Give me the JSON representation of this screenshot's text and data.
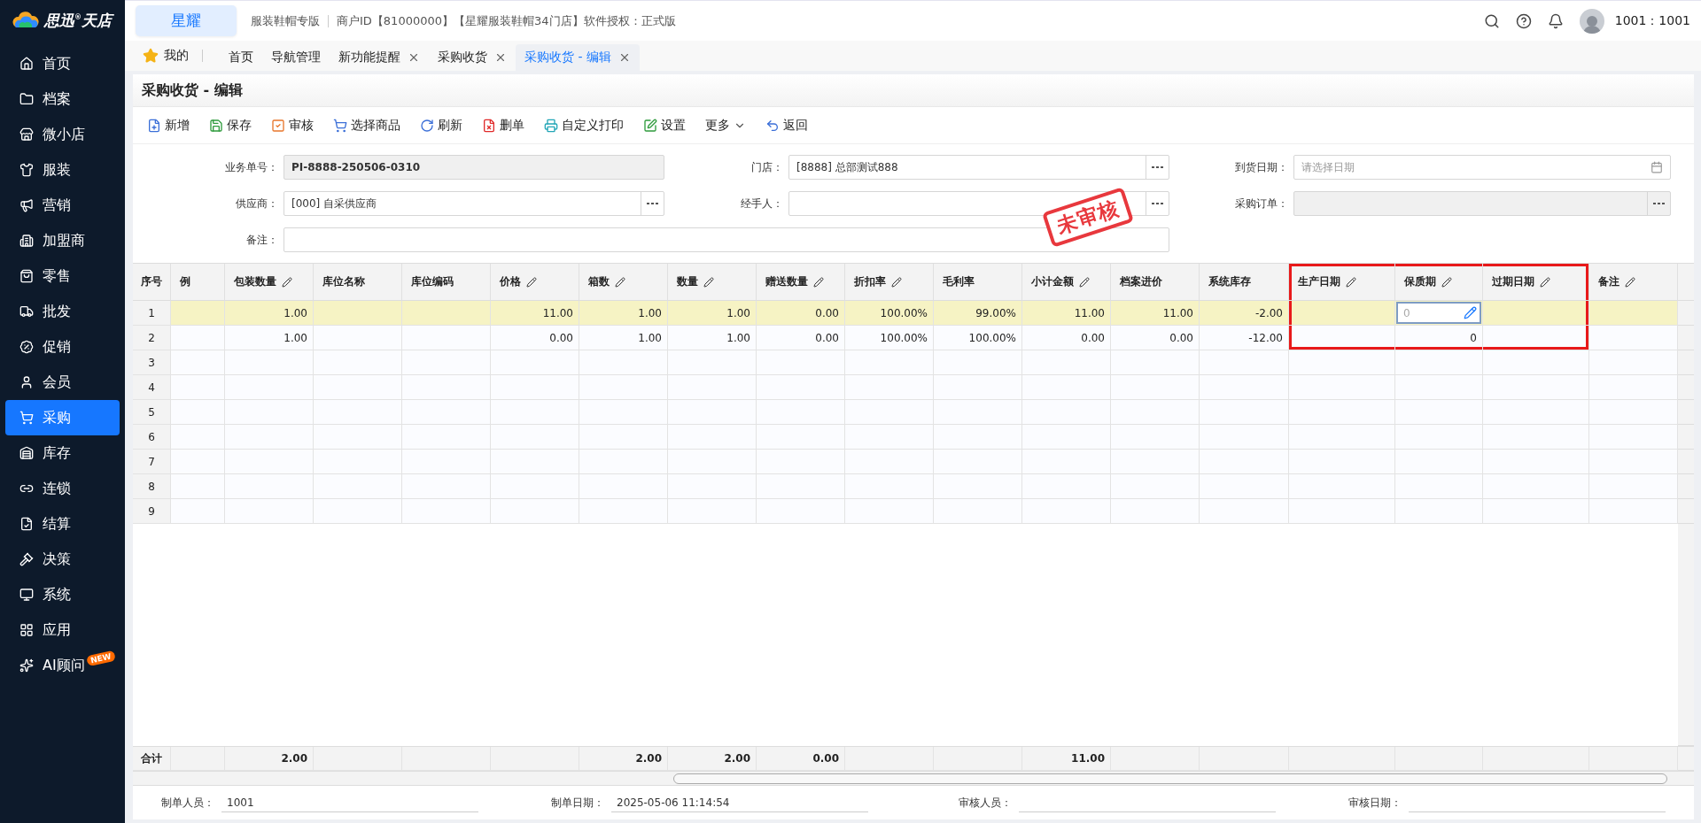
{
  "logo": {
    "text": "思迅$^{®}$天店"
  },
  "sidebar": {
    "items": [
      {
        "label": "首页",
        "selected": false
      },
      {
        "label": "档案",
        "selected": false
      },
      {
        "label": "微小店",
        "selected": false
      },
      {
        "label": "服装",
        "selected": false
      },
      {
        "label": "营销",
        "selected": false
      },
      {
        "label": "加盟商",
        "selected": false
      },
      {
        "label": "零售",
        "selected": false
      },
      {
        "label": "批发",
        "selected": false
      },
      {
        "label": "促销",
        "selected": false
      },
      {
        "label": "会员",
        "selected": false
      },
      {
        "label": "采购",
        "selected": true
      },
      {
        "label": "库存",
        "selected": false
      },
      {
        "label": "连锁",
        "selected": false
      },
      {
        "label": "结算",
        "selected": false
      },
      {
        "label": "决策",
        "selected": false
      },
      {
        "label": "系统",
        "selected": false
      },
      {
        "label": "应用",
        "selected": false
      },
      {
        "label": "AI顾问",
        "selected": false,
        "badge": "NEW"
      }
    ]
  },
  "header": {
    "brand": "星耀",
    "edition": "服装鞋帽专版",
    "info": "商户ID【81000000】【星耀服装鞋帽34门店】软件授权：正式版",
    "user": "1001：1001"
  },
  "tabs": {
    "favorites": "我的",
    "items": [
      {
        "label": "首页",
        "selected": false,
        "closable": false
      },
      {
        "label": "导航管理",
        "selected": false,
        "closable": false
      },
      {
        "label": "新功能提醒",
        "selected": false,
        "closable": true
      },
      {
        "label": "采购收货",
        "selected": false,
        "closable": true
      },
      {
        "label": "采购收货 - 编辑",
        "selected": true,
        "closable": true
      }
    ]
  },
  "page": {
    "title": "采购收货 - 编辑"
  },
  "toolbar": [
    {
      "label": "新增",
      "kind": "add"
    },
    {
      "label": "保存",
      "kind": "save"
    },
    {
      "label": "审核",
      "kind": "approve"
    },
    {
      "label": "选择商品",
      "kind": "cart"
    },
    {
      "label": "刷新",
      "kind": "refresh"
    },
    {
      "label": "删单",
      "kind": "delete"
    },
    {
      "label": "自定义打印",
      "kind": "print"
    },
    {
      "label": "设置",
      "kind": "settings"
    },
    {
      "label": "更多",
      "kind": "more"
    },
    {
      "label": "返回",
      "kind": "back"
    }
  ],
  "form": {
    "stamp": "未审核",
    "fields": [
      {
        "label": "业务单号：",
        "value": "PI-8888-250506-0310",
        "kind": "code",
        "disabled": true
      },
      {
        "label": "门店：",
        "value": "[8888] 总部测试888",
        "kind": "lookup",
        "disabled": false
      },
      {
        "label": "到货日期：",
        "placeholder": "请选择日期",
        "kind": "date",
        "disabled": false
      },
      {
        "label": "供应商：",
        "value": "[000] 自采供应商",
        "kind": "lookup",
        "disabled": false
      },
      {
        "label": "经手人：",
        "kind": "lookup",
        "disabled": false
      },
      {
        "label": "采购订单：",
        "kind": "lookup",
        "disabled": true
      },
      {
        "label": "备注：",
        "kind": "note",
        "disabled": false
      }
    ]
  },
  "table": {
    "columns": [
      {
        "label": "序号",
        "editable": false,
        "framed": false,
        "total": "合计"
      },
      {
        "label": "例",
        "editable": false,
        "framed": false
      },
      {
        "label": "包装数量",
        "editable": true,
        "framed": false,
        "total": "2.00"
      },
      {
        "label": "库位名称",
        "editable": false,
        "framed": false
      },
      {
        "label": "库位编码",
        "editable": false,
        "framed": false
      },
      {
        "label": "价格",
        "editable": true,
        "framed": false
      },
      {
        "label": "箱数",
        "editable": true,
        "framed": false,
        "total": "2.00"
      },
      {
        "label": "数量",
        "editable": true,
        "framed": false,
        "total": "2.00"
      },
      {
        "label": "赠送数量",
        "editable": true,
        "framed": false,
        "total": "0.00"
      },
      {
        "label": "折扣率",
        "editable": true,
        "framed": false
      },
      {
        "label": "毛利率",
        "editable": false,
        "framed": false
      },
      {
        "label": "小计金额",
        "editable": true,
        "framed": false,
        "total": "11.00"
      },
      {
        "label": "档案进价",
        "editable": false,
        "framed": false
      },
      {
        "label": "系统库存",
        "editable": false,
        "framed": false
      },
      {
        "label": "生产日期",
        "editable": true,
        "framed": true
      },
      {
        "label": "保质期",
        "editable": true,
        "framed": true
      },
      {
        "label": "过期日期",
        "editable": true,
        "framed": true
      },
      {
        "label": "备注",
        "editable": true,
        "framed": false
      }
    ],
    "rows": [
      {
        "selected": true,
        "framed": true,
        "cells": [
          "1",
          null,
          "1.00",
          null,
          null,
          "11.00",
          "1.00",
          "1.00",
          "0.00",
          "100.00%",
          "99.00%",
          "11.00",
          "11.00",
          "-2.00",
          null,
          {
            "kind": "input",
            "placeholder": "0"
          },
          null,
          null
        ]
      },
      {
        "selected": false,
        "framed": true,
        "cells": [
          "2",
          null,
          "1.00",
          null,
          null,
          "0.00",
          "1.00",
          "1.00",
          "0.00",
          "100.00%",
          "100.00%",
          "0.00",
          "0.00",
          "-12.00",
          null,
          "0",
          null,
          null
        ]
      },
      {
        "selected": false,
        "framed": false,
        "cells": [
          "3"
        ]
      },
      {
        "selected": false,
        "framed": false,
        "cells": [
          "4"
        ]
      },
      {
        "selected": false,
        "framed": false,
        "cells": [
          "5"
        ]
      },
      {
        "selected": false,
        "framed": false,
        "cells": [
          "6"
        ]
      },
      {
        "selected": false,
        "framed": false,
        "cells": [
          "7"
        ]
      },
      {
        "selected": false,
        "framed": false,
        "cells": [
          "8"
        ]
      },
      {
        "selected": false,
        "framed": false,
        "cells": [
          "9"
        ]
      }
    ]
  },
  "footer": [
    {
      "label": "制单人员：",
      "value": "1001"
    },
    {
      "label": "制单日期：",
      "value": "2025-05-06 11:14:54"
    },
    {
      "label": "审核人员："
    },
    {
      "label": "审核日期："
    }
  ]
}
